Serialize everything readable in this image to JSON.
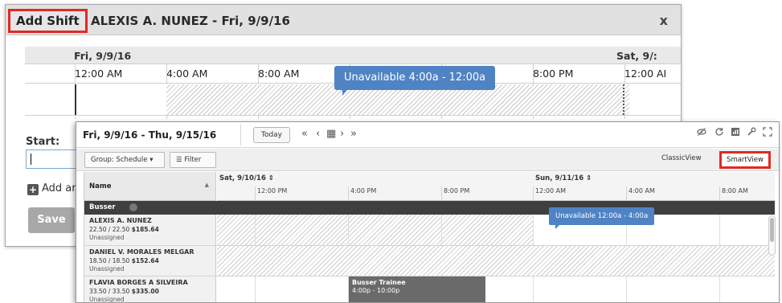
{
  "dialog": {
    "tab_label": "Add Shift",
    "title": "ALEXIS A. NUNEZ - Fri, 9/9/16",
    "close": "x",
    "mini_dates": [
      "Fri, 9/9/16",
      "Sat, 9/:"
    ],
    "mini_times": [
      "12:00 AM",
      "4:00 AM",
      "8:00 AM",
      "8:00 PM",
      "12:00 AI"
    ],
    "tooltip": "Unavailable 4:00a - 12:00a",
    "start_label": "Start:",
    "add_and": "Add anc",
    "save": "Save"
  },
  "scheduler": {
    "date_range": "Fri, 9/9/16 - Thu, 9/15/16",
    "today": "Today",
    "nav": {
      "first": "«",
      "prev": "‹",
      "cal": "▦",
      "next": "›",
      "last": "»"
    },
    "tool_icons": [
      "hide-icon",
      "refresh-icon",
      "chart-icon",
      "wrench-icon",
      "fullscreen-icon"
    ],
    "group_by": "Group: Schedule ▾",
    "filter": "Filter",
    "classic_view": "ClassicView",
    "smart_view": "SmartView",
    "name_header": "Name",
    "days": [
      "Sat, 9/10/16 ⇕",
      "Sun, 9/11/16 ⇕"
    ],
    "times": [
      "12:00 PM",
      "4:00 PM",
      "8:00 PM",
      "12:00 AM",
      "4:00 AM",
      "8:00 AM"
    ],
    "group": "Busser",
    "rows": [
      {
        "name": "ALEXIS A. NUNEZ",
        "hours": "22.50 / 22.50",
        "pay": "$185.64",
        "status": "Unassigned"
      },
      {
        "name": "DANIEL V. MORALES MELGAR",
        "hours": "18.50 / 18.50",
        "pay": "$152.64",
        "status": "Unassigned"
      },
      {
        "name": "FLAVIA BORGES A SILVEIRA",
        "hours": "33.50 / 33.50",
        "pay": "$335.00",
        "status": "Unassigned"
      }
    ],
    "unavailable_tip": "Unavailable 12:00a - 4:00a",
    "shift": {
      "title": "Busser Trainee",
      "time": "4:00p - 10:00p"
    }
  },
  "colors": {
    "highlight": "#e02a25",
    "tooltip": "#4f83c4",
    "group_bar": "#3f3f3f",
    "shift": "#6a6a6a"
  }
}
